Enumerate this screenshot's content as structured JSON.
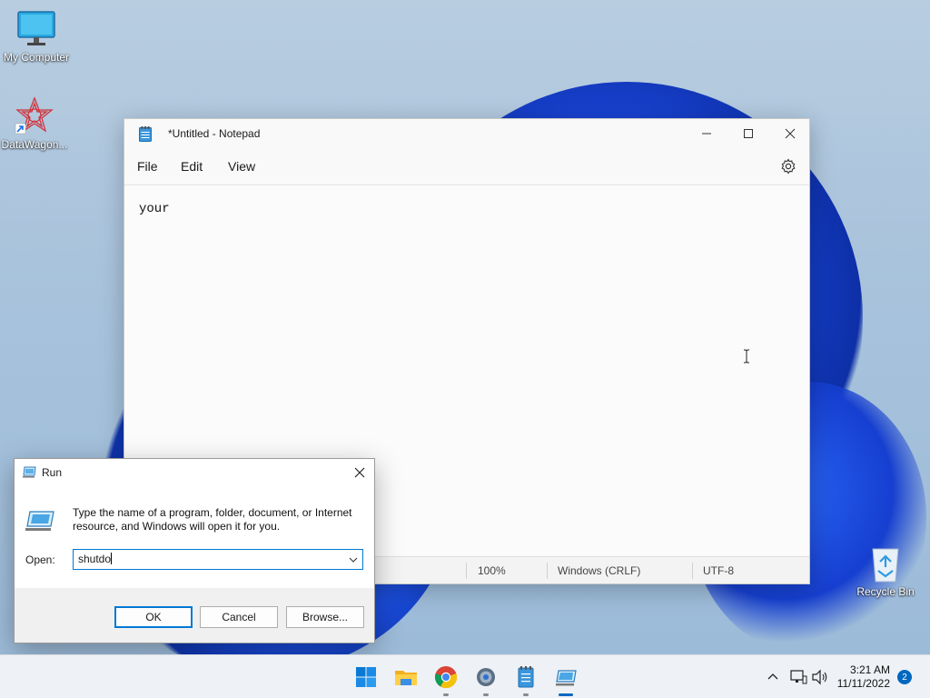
{
  "desktop": {
    "icons": [
      {
        "label": "My Computer",
        "icon": "monitor-icon"
      },
      {
        "label": "DataWagon...",
        "icon": "datawagon-icon"
      },
      {
        "label": "Recycle Bin",
        "icon": "recycle-bin-icon"
      }
    ]
  },
  "notepad": {
    "title": "*Untitled - Notepad",
    "menu": [
      "File",
      "Edit",
      "View"
    ],
    "content": "your",
    "status": {
      "zoom": "100%",
      "line_ending": "Windows (CRLF)",
      "encoding": "UTF-8"
    }
  },
  "run_dialog": {
    "title": "Run",
    "description": "Type the name of a program, folder, document, or Internet resource, and Windows will open it for you.",
    "open_label": "Open:",
    "open_value": "shutdo",
    "buttons": {
      "ok": "OK",
      "cancel": "Cancel",
      "browse": "Browse..."
    }
  },
  "taskbar": {
    "apps": [
      "start-icon",
      "file-explorer-icon",
      "chrome-icon",
      "settings-icon",
      "notepad-icon",
      "run-icon"
    ],
    "clock": {
      "time": "3:21 AM",
      "date": "11/11/2022"
    },
    "notification_count": "2"
  },
  "colors": {
    "accent": "#0078d4",
    "taskbar_accent": "#0067c0"
  }
}
